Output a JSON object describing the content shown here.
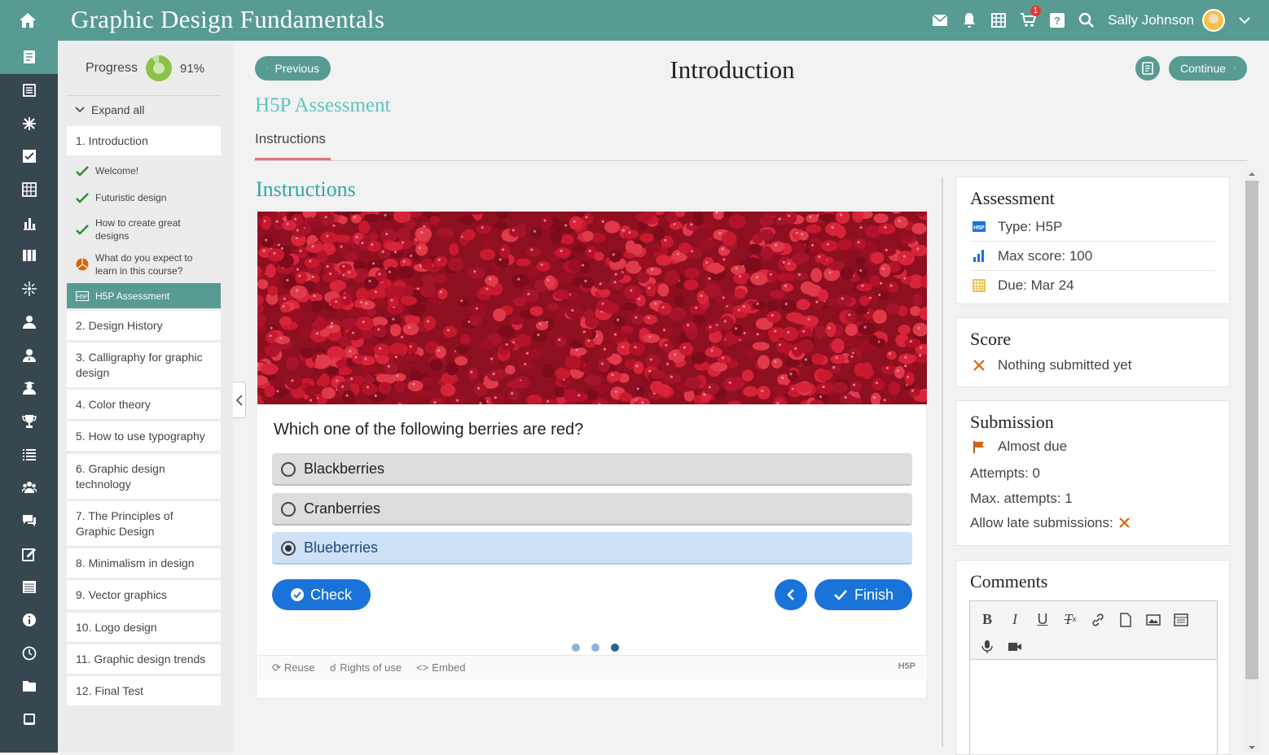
{
  "topbar": {
    "app_title": "Graphic Design Fundamentals",
    "user_name": "Sally Johnson",
    "cart_badge": "1",
    "icons": [
      "home-icon",
      "mail-icon",
      "bell-icon",
      "calendar-icon",
      "cart-icon",
      "help-icon",
      "search-icon",
      "avatar",
      "chevron-down-icon"
    ]
  },
  "leftnav": {
    "icons": [
      "notebook-icon",
      "newspaper-icon",
      "asterisk-icon",
      "checkbox-icon",
      "grid-icon",
      "bar-chart-icon",
      "columns-icon",
      "sparkle-icon",
      "user-icon",
      "user-tie-icon",
      "user-graduate-icon",
      "trophy-icon",
      "list-icon",
      "users-icon",
      "chat-icon",
      "edit-icon",
      "table-icon",
      "info-icon",
      "clock-icon",
      "folder-icon",
      "tablet-icon"
    ]
  },
  "outline": {
    "progress_label": "Progress",
    "progress_percent": "91%",
    "progress_value": 0.91,
    "expand_all": "Expand all",
    "sections": [
      {
        "label": "1. Introduction"
      },
      {
        "label": "2. Design History"
      },
      {
        "label": "3. Calligraphy for graphic design"
      },
      {
        "label": "4. Color theory"
      },
      {
        "label": "5. How to use typography"
      },
      {
        "label": "6. Graphic design technology"
      },
      {
        "label": "7. The Principles of Graphic Design"
      },
      {
        "label": "8. Minimalism in design"
      },
      {
        "label": "9. Vector graphics"
      },
      {
        "label": "10. Logo design"
      },
      {
        "label": "11. Graphic design trends"
      },
      {
        "label": "12. Final Test"
      }
    ],
    "subitems": [
      {
        "label": "Welcome!",
        "status": "done"
      },
      {
        "label": "Futuristic design",
        "status": "done"
      },
      {
        "label": "How to create great designs",
        "status": "done"
      },
      {
        "label": "What do you expect to learn in this course?",
        "status": "survey"
      },
      {
        "label": "H5P Assessment",
        "status": "current"
      }
    ]
  },
  "header": {
    "previous_label": "Previous",
    "continue_label": "Continue",
    "page_title": "Introduction"
  },
  "content": {
    "activity_title": "H5P Assessment",
    "tab_label": "Instructions",
    "section_heading": "Instructions"
  },
  "h5p": {
    "question": "Which one of the following berries are red?",
    "options": [
      {
        "label": "Blackberries",
        "selected": false
      },
      {
        "label": "Cranberries",
        "selected": false
      },
      {
        "label": "Blueberries",
        "selected": true
      }
    ],
    "check_label": "Check",
    "finish_label": "Finish",
    "current_page": 3,
    "total_pages": 3,
    "footer": {
      "reuse": "Reuse",
      "rights": "Rights of use",
      "embed": "Embed",
      "logo": "H5P"
    }
  },
  "assessment": {
    "heading": "Assessment",
    "type": "Type: H5P",
    "max_score": "Max score: 100",
    "due": "Due: Mar 24"
  },
  "score": {
    "heading": "Score",
    "status": "Nothing submitted yet"
  },
  "submission": {
    "heading": "Submission",
    "status": "Almost due",
    "attempts": "Attempts: 0",
    "max_attempts": "Max. attempts: 1",
    "late": "Allow late submissions:"
  },
  "comments": {
    "heading": "Comments",
    "toolbar": [
      "bold",
      "italic",
      "underline",
      "clear-format",
      "link",
      "file",
      "image",
      "embed",
      "microphone",
      "video"
    ]
  },
  "colors": {
    "brand": "#579b92",
    "nav_dark": "#37474f",
    "h5p_blue": "#1a73d9",
    "accent_teal": "#61c4bd",
    "tab_underline": "#e57373",
    "warning_orange": "#d9640f"
  }
}
